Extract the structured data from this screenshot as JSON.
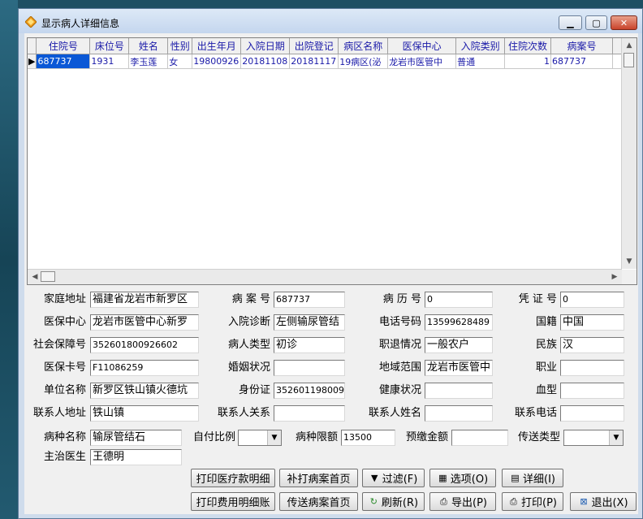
{
  "window": {
    "title": "显示病人详细信息"
  },
  "grid": {
    "columns": [
      "住院号",
      "床位号",
      "姓名",
      "性别",
      "出生年月",
      "入院日期",
      "出院登记",
      "病区名称",
      "医保中心",
      "入院类别",
      "住院次数",
      "病案号"
    ],
    "row": {
      "indicator": "▶",
      "cells": [
        "687737",
        "1931",
        "李玉莲",
        "女",
        "19800926",
        "20181108",
        "20181117",
        "19病区(泌",
        "龙岩市医管中",
        "普通",
        "1",
        "687737"
      ]
    }
  },
  "form": {
    "home_address": {
      "label": "家庭地址",
      "value": "福建省龙岩市新罗区"
    },
    "case_no": {
      "label": "病 案 号",
      "value": "687737"
    },
    "history_no": {
      "label": "病 历 号",
      "value": "0"
    },
    "voucher_no": {
      "label": "凭 证 号",
      "value": "0"
    },
    "insurance_center": {
      "label": "医保中心",
      "value": "龙岩市医管中心新罗"
    },
    "admit_diagnosis": {
      "label": "入院诊断",
      "value": "左侧输尿管结"
    },
    "phone": {
      "label": "电话号码",
      "value": "13599628489"
    },
    "nationality": {
      "label": "国籍",
      "value": "中国"
    },
    "social_security_no": {
      "label": "社会保障号",
      "value": "352601800926602"
    },
    "patient_type": {
      "label": "病人类型",
      "value": "初诊"
    },
    "retirement": {
      "label": "职退情况",
      "value": "一般农户"
    },
    "ethnicity": {
      "label": "民族",
      "value": "汉"
    },
    "insurance_card": {
      "label": "医保卡号",
      "value": "F11086259"
    },
    "marital": {
      "label": "婚姻状况",
      "value": ""
    },
    "region": {
      "label": "地域范围",
      "value": "龙岩市医管中"
    },
    "occupation": {
      "label": "职业",
      "value": ""
    },
    "employer": {
      "label": "单位名称",
      "value": "新罗区铁山镇火德坑"
    },
    "id_card": {
      "label": "身份证",
      "value": "352601198009"
    },
    "health": {
      "label": "健康状况",
      "value": ""
    },
    "blood_type": {
      "label": "血型",
      "value": ""
    },
    "contact_address": {
      "label": "联系人地址",
      "value": "铁山镇"
    },
    "contact_relation": {
      "label": "联系人关系",
      "value": ""
    },
    "contact_name": {
      "label": "联系人姓名",
      "value": ""
    },
    "contact_phone": {
      "label": "联系电话",
      "value": ""
    },
    "disease_name": {
      "label": "病种名称",
      "value": "输尿管结石"
    },
    "self_pay_ratio": {
      "label": "自付比例",
      "value": ""
    },
    "disease_limit": {
      "label": "病种限额",
      "value": "13500"
    },
    "prepay": {
      "label": "预缴金额",
      "value": ""
    },
    "send_type": {
      "label": "传送类型",
      "value": ""
    },
    "attending_doctor": {
      "label": "主治医生",
      "value": "王德明"
    }
  },
  "buttons": {
    "print_medical_detail": "打印医疗款明细",
    "reprint_case_front": "补打病案首页",
    "filter": "过滤(F)",
    "options": "选项(O)",
    "detail": "详细(I)",
    "print_fee_detail": "打印费用明细账",
    "send_case_front": "传送病案首页",
    "refresh": "刷新(R)",
    "export": "导出(P)",
    "print": "打印(P)",
    "exit": "退出(X)"
  }
}
